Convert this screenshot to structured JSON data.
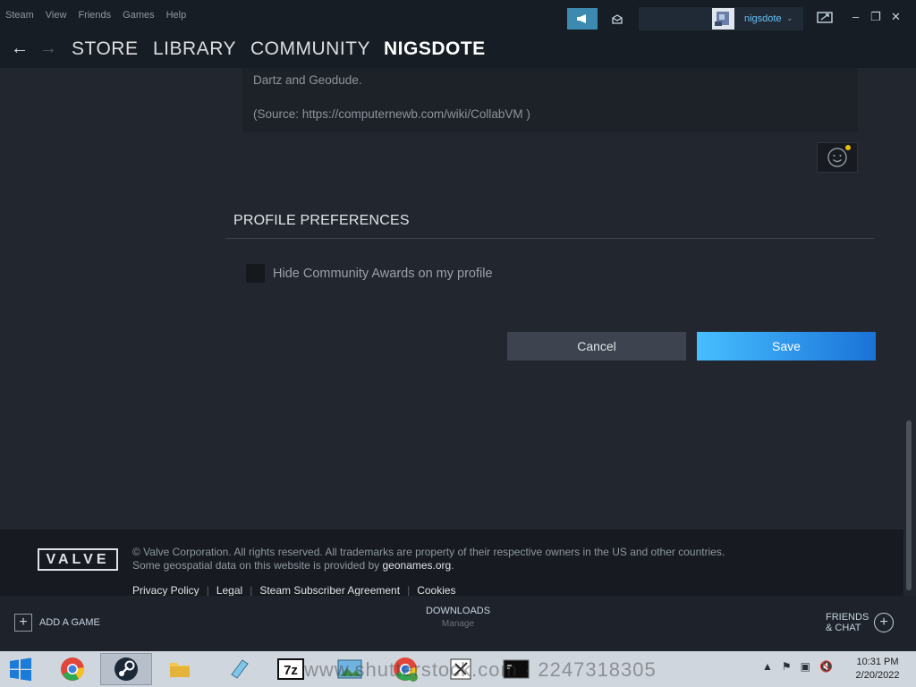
{
  "menu": {
    "items": [
      "Steam",
      "View",
      "Friends",
      "Games",
      "Help"
    ]
  },
  "account": {
    "username": "nigsdote",
    "caret": "⌄"
  },
  "window_controls": {
    "minimize": "–",
    "maximize": "❐",
    "close": "✕"
  },
  "nav": {
    "back": "←",
    "forward": "→",
    "store": "STORE",
    "library": "LIBRARY",
    "community": "COMMUNITY",
    "profile": "NIGSDOTE"
  },
  "summary": {
    "line1": "Dartz and Geodude.",
    "line2": "(Source: https://computernewb.com/wiki/CollabVM )"
  },
  "preferences": {
    "title": "PROFILE PREFERENCES",
    "hide_awards_label": "Hide Community Awards on my profile",
    "hide_awards_checked": false
  },
  "actions": {
    "cancel": "Cancel",
    "save": "Save"
  },
  "footer": {
    "logo": "VALVE",
    "copyright": "© Valve Corporation. All rights reserved. All trademarks are property of their respective owners in the US and other countries.",
    "geo_prefix": "Some geospatial data on this website is provided by ",
    "geo_link": "geonames.org",
    "geo_suffix": ".",
    "links": [
      "Privacy Policy",
      "Legal",
      "Steam Subscriber Agreement",
      "Cookies"
    ]
  },
  "bottombar": {
    "add_game": "ADD A GAME",
    "downloads": "DOWNLOADS",
    "downloads_sub": "Manage",
    "friends_line1": "FRIENDS",
    "friends_line2": "& CHAT"
  },
  "taskbar": {
    "clock_time": "10:31 PM",
    "clock_date": "2/20/2022",
    "watermark": "www.shutterstock.com · 2247318305"
  },
  "colors": {
    "accent": "#67c1f5",
    "save_gradient_start": "#47bfff",
    "save_gradient_end": "#1a72d8",
    "content_bg": "#22262e"
  }
}
